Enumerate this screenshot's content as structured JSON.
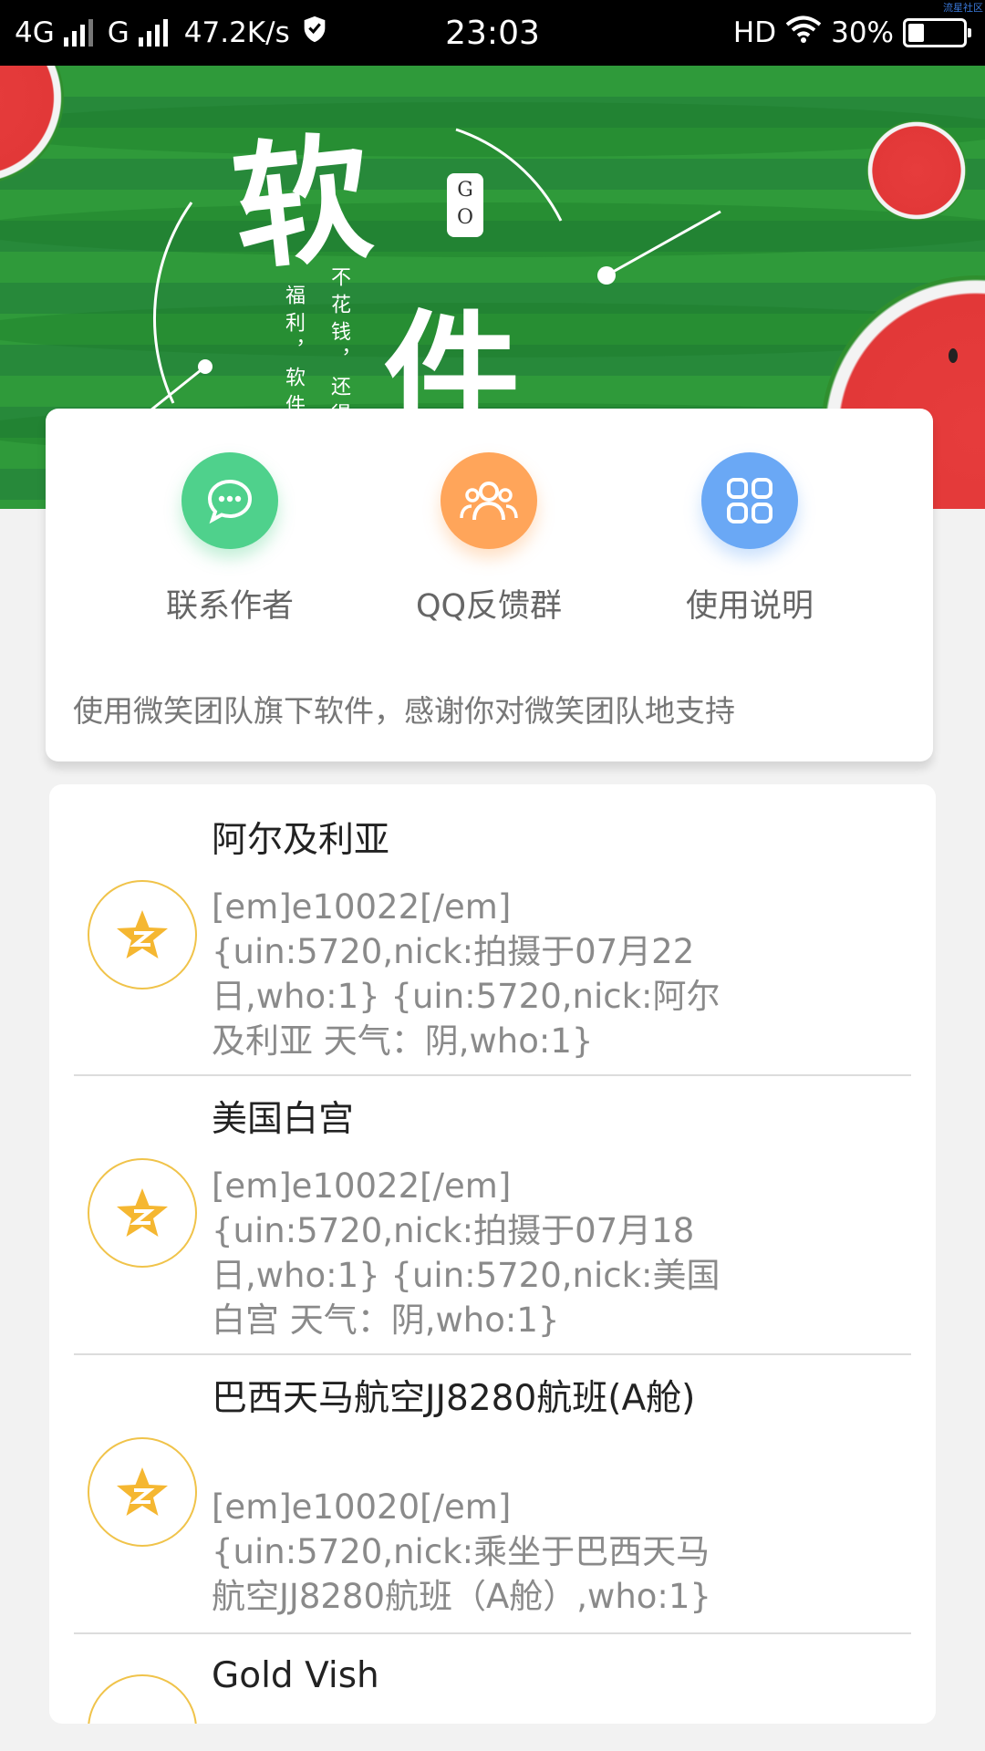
{
  "status_bar": {
    "network_1": "4G",
    "network_2": "G",
    "speed": "47.2K/s",
    "time": "23:03",
    "hd": "HD",
    "battery": "30%",
    "battery_level": 0.3,
    "watermark": "流星社区"
  },
  "banner": {
    "title_char_1": "软",
    "title_char_2": "件",
    "go_badge": "G\nO",
    "vertical_left": "福利，软件",
    "vertical_right": "不花钱，还得"
  },
  "quick_actions": [
    {
      "label": "联系作者",
      "icon": "chat-icon",
      "color": "#4fd18c"
    },
    {
      "label": "QQ反馈群",
      "icon": "group-icon",
      "color": "#ffa55a"
    },
    {
      "label": "使用说明",
      "icon": "grid-icon",
      "color": "#6aa8f5"
    }
  ],
  "quick_note": "使用微笑团队旗下软件，感谢你对微笑团队地支持",
  "list": [
    {
      "title": "阿尔及利亚",
      "desc": "[em]e10022[/em] {uin:5720,nick:拍摄于07月22日,who:1} {uin:5720,nick:阿尔及利亚 天气：阴,who:1}"
    },
    {
      "title": "美国白宫",
      "desc": "[em]e10022[/em] {uin:5720,nick:拍摄于07月18日,who:1} {uin:5720,nick:美国白宫 天气：阴,who:1}"
    },
    {
      "title": "巴西天马航空JJ8280航班(A舱)",
      "desc": "[em]e10020[/em]{uin:5720,nick:乘坐于巴西天马航空JJ8280航班（A舱）,who:1}"
    },
    {
      "title": "Gold Vish",
      "desc": ""
    }
  ],
  "colors": {
    "qzone_star": "#f5b731",
    "banner_green": "#2f9a3a"
  }
}
